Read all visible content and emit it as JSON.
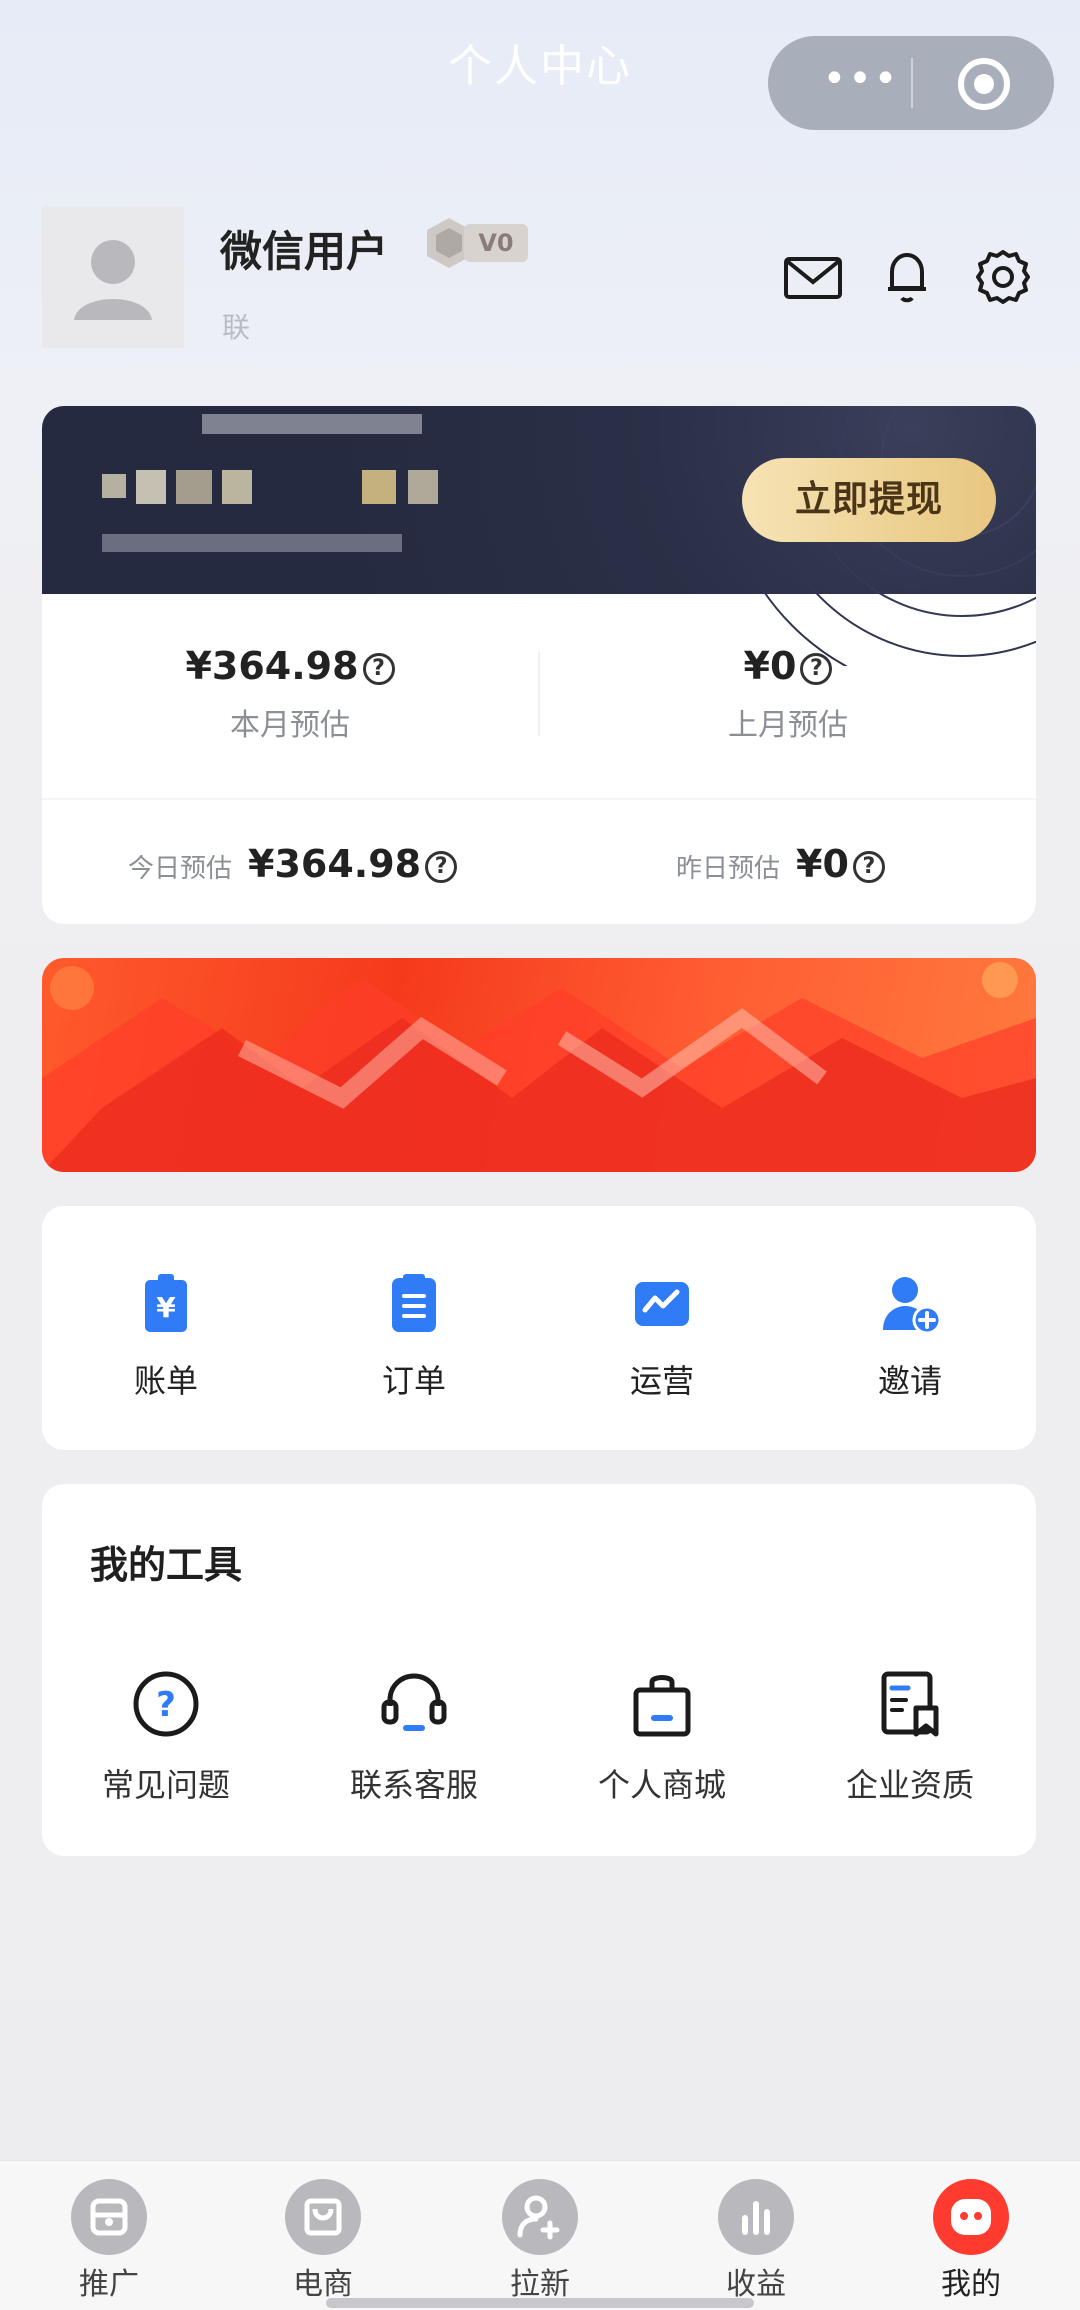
{
  "header": {
    "title": "个人中心"
  },
  "capsule": {
    "more_icon": "more-dots-icon",
    "close_icon": "target-circle-icon"
  },
  "profile": {
    "name": "微信用户",
    "level": "V0",
    "sub_text": "联",
    "actions": [
      "mail-icon",
      "bell-icon",
      "gear-icon"
    ]
  },
  "earnings": {
    "withdraw_label": "立即提现",
    "this_month": {
      "value": "¥364.98",
      "label": "本月预估"
    },
    "last_month": {
      "value": "¥0",
      "label": "上月预估"
    },
    "today": {
      "label": "今日预估",
      "value": "¥364.98"
    },
    "yesterday": {
      "label": "昨日预估",
      "value": "¥0"
    },
    "help_glyph": "?"
  },
  "quick_actions": [
    {
      "label": "账单",
      "icon": "bill-icon"
    },
    {
      "label": "订单",
      "icon": "order-icon"
    },
    {
      "label": "运营",
      "icon": "operation-icon"
    },
    {
      "label": "邀请",
      "icon": "invite-icon"
    }
  ],
  "tools": {
    "title": "我的工具",
    "items": [
      {
        "label": "常见问题",
        "icon": "faq-icon"
      },
      {
        "label": "联系客服",
        "icon": "headset-icon"
      },
      {
        "label": "个人商城",
        "icon": "shopping-bag-icon"
      },
      {
        "label": "企业资质",
        "icon": "certificate-icon"
      }
    ]
  },
  "tabbar": {
    "items": [
      {
        "label": "推广",
        "icon": "promote-icon"
      },
      {
        "label": "电商",
        "icon": "ecommerce-icon"
      },
      {
        "label": "拉新",
        "icon": "add-user-icon"
      },
      {
        "label": "收益",
        "icon": "earnings-chart-icon"
      },
      {
        "label": "我的",
        "icon": "me-icon"
      }
    ],
    "active": "我的"
  },
  "colors": {
    "accent_blue": "#2f7cf6",
    "tab_active": "#ff3b2f",
    "withdraw_gold": "#e8c780",
    "card_dark": "#2b2f47"
  }
}
